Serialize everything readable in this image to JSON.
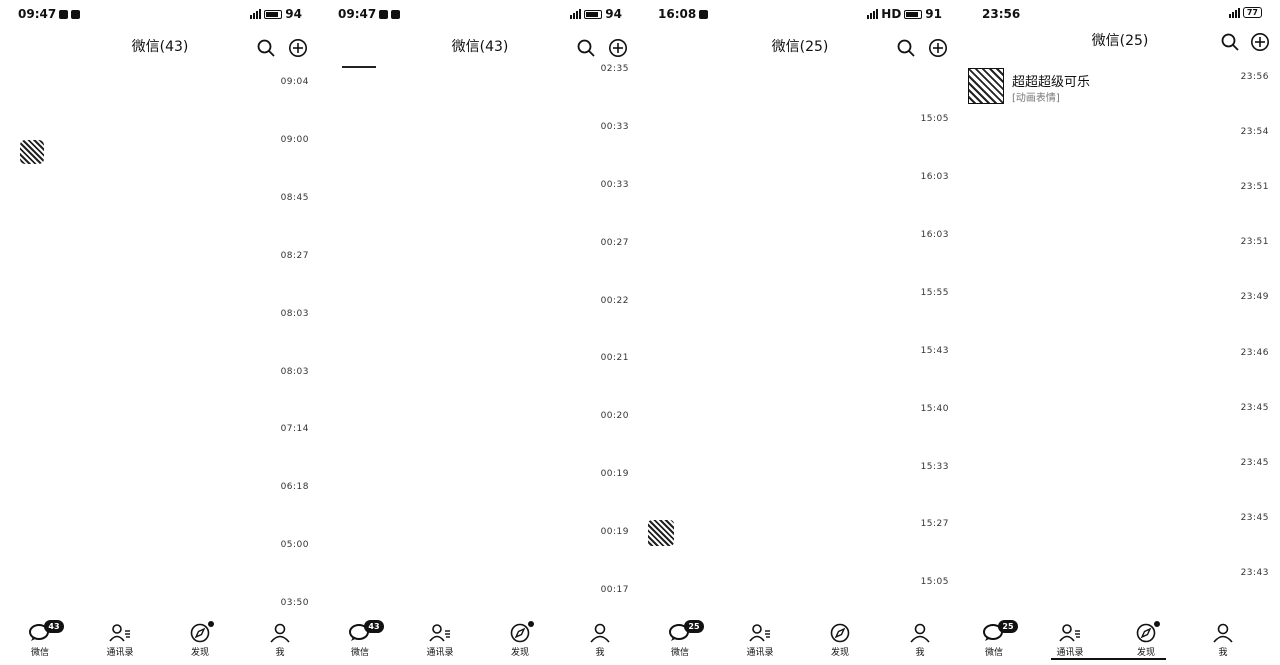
{
  "screens": [
    {
      "status": {
        "time": "09:47",
        "battery": "94"
      },
      "title": "微信(43)",
      "times": [
        "09:04",
        "09:00",
        "08:45",
        "08:27",
        "08:03",
        "08:03",
        "07:14",
        "06:18",
        "05:00",
        "03:50"
      ],
      "tabs": {
        "chats": "微信",
        "contacts": "通讯录",
        "discover": "发现",
        "me": "我",
        "badge": "43"
      }
    },
    {
      "status": {
        "time": "09:47",
        "battery": "94"
      },
      "title": "微信(43)",
      "times": [
        "02:35",
        "00:33",
        "00:33",
        "00:27",
        "00:22",
        "00:21",
        "00:20",
        "00:19",
        "00:19",
        "00:17"
      ],
      "tabs": {
        "chats": "微信",
        "contacts": "通讯录",
        "discover": "发现",
        "me": "我",
        "badge": "43"
      }
    },
    {
      "status": {
        "time": "16:08",
        "network": "HD",
        "battery": "91"
      },
      "title": "微信(25)",
      "times": [
        "15:05",
        "16:03",
        "16:03",
        "15:55",
        "15:43",
        "15:40",
        "15:33",
        "15:27",
        "15:05"
      ],
      "tabs": {
        "chats": "微信",
        "contacts": "通讯录",
        "discover": "发现",
        "me": "我",
        "badge": "25"
      }
    },
    {
      "status": {
        "time": "23:56",
        "battery": "77"
      },
      "title": "微信(25)",
      "chat": {
        "name": "超超超级可乐",
        "preview": "[动画表情]"
      },
      "times": [
        "23:56",
        "23:54",
        "23:51",
        "23:51",
        "23:49",
        "23:46",
        "23:45",
        "23:45",
        "23:45",
        "23:43"
      ],
      "tabs": {
        "chats": "微信",
        "contacts": "通讯录",
        "discover": "发现",
        "me": "我",
        "badge": "25"
      }
    }
  ]
}
